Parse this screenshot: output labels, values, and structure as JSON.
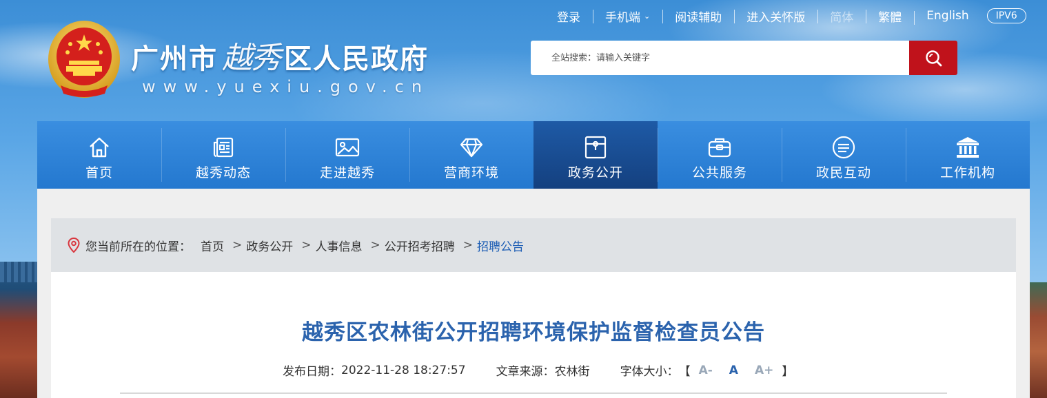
{
  "header": {
    "title_left": "广州市",
    "title_calligraphy": "越秀",
    "title_right": "区人民政府",
    "url": "www.yuexiu.gov.cn"
  },
  "top_links": {
    "login": "登录",
    "mobile": "手机端",
    "reading_aid": "阅读辅助",
    "enter_guan": "进入关怀版",
    "simplified": "简体",
    "traditional": "繁體",
    "english": "English",
    "ipv6": "IPV6"
  },
  "search": {
    "placeholder": "全站搜索：请输入关键字"
  },
  "nav": {
    "items": [
      {
        "label": "首页",
        "icon": "home-icon"
      },
      {
        "label": "越秀动态",
        "icon": "newspaper-icon"
      },
      {
        "label": "走进越秀",
        "icon": "picture-icon"
      },
      {
        "label": "营商环境",
        "icon": "diamond-icon"
      },
      {
        "label": "政务公开",
        "icon": "folder-icon"
      },
      {
        "label": "公共服务",
        "icon": "briefcase-icon"
      },
      {
        "label": "政民互动",
        "icon": "chat-icon"
      },
      {
        "label": "工作机构",
        "icon": "institution-icon"
      }
    ],
    "active_index": 4
  },
  "breadcrumb": {
    "prefix": "您当前所在的位置：",
    "items": [
      "首页",
      "政务公开",
      "人事信息",
      "公开招考招聘",
      "招聘公告"
    ]
  },
  "article": {
    "title": "越秀区农林街公开招聘环境保护监督检查员公告",
    "publish_label": "发布日期：",
    "publish_date": "2022-11-28 18:27:57",
    "source_label": "文章来源：",
    "source": "农林街",
    "font_label": "字体大小：",
    "bracket_open": "【",
    "bracket_close": "】",
    "font_small": "A-",
    "font_medium": "A",
    "font_large": "A+"
  },
  "colors": {
    "nav_blue": "#2478cf",
    "nav_active": "#14407f",
    "search_red": "#c0121b",
    "title_blue": "#2b63ad"
  }
}
